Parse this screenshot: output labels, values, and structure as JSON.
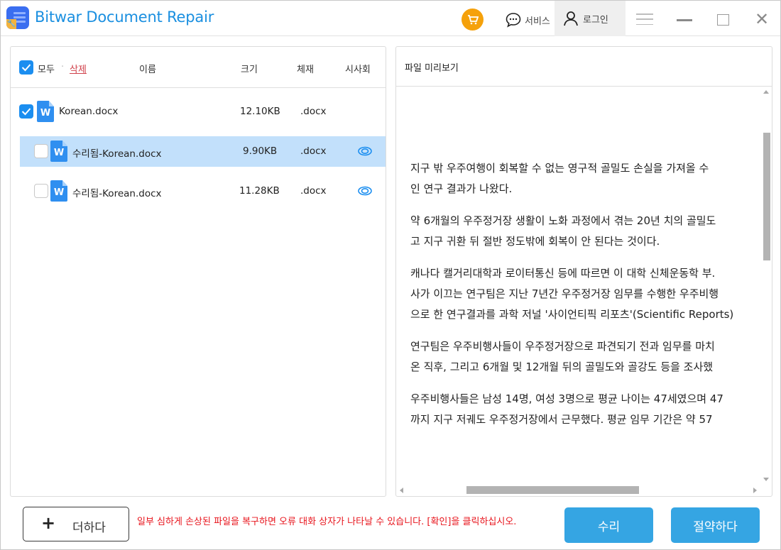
{
  "app": {
    "title": "Bitwar Document Repair"
  },
  "titlebar": {
    "service_label": "서비스",
    "login_label": "로그인",
    "cart_color": "#f5a10b"
  },
  "file_list": {
    "header": {
      "select_all_label": "모두",
      "separator": "·",
      "delete_label": "삭제",
      "name_col": "이름",
      "size_col": "크기",
      "format_col": "체재",
      "preview_col": "시사회",
      "select_all_checked": true
    },
    "rows": [
      {
        "name": "Korean.docx",
        "size": "12.10KB",
        "format": ".docx",
        "checked": true,
        "selected": false,
        "level": 0,
        "has_preview": false
      },
      {
        "name": "수리됨-Korean.docx",
        "size": "9.90KB",
        "format": ".docx",
        "checked": false,
        "selected": true,
        "level": 1,
        "has_preview": true
      },
      {
        "name": "수리됨-Korean.docx",
        "size": "11.28KB",
        "format": ".docx",
        "checked": false,
        "selected": false,
        "level": 1,
        "has_preview": true
      }
    ],
    "icon_letter": "W"
  },
  "preview": {
    "title": "파일 미리보기",
    "paragraphs": [
      [
        "지구 밖 우주여행이 회복할 수 없는 영구적 골밀도 손실을 가져올 수",
        "인 연구 결과가 나왔다."
      ],
      [
        "약 6개월의 우주정거장 생활이 노화 과정에서 겪는 20년 치의 골밀도",
        "고 지구 귀환 뒤 절반 정도밖에 회복이 안 된다는 것이다."
      ],
      [
        "캐나다 캘거리대학과 로이터통신 등에 따르면 이 대학 신체운동학 부.",
        "사가 이끄는 연구팀은 지난 7년간 우주정거장 임무를 수행한 우주비행",
        "으로 한 연구결과를 과학 저널 '사이언티픽 리포츠'(Scientific Reports)"
      ],
      [
        "연구팀은 우주비행사들이 우주정거장으로 파견되기 전과 임무를 마치",
        "온 직후, 그리고 6개월 및 12개월 뒤의 골밀도와 골강도 등을 조사했"
      ],
      [
        "우주비행사들은 남성 14명, 여성 3명으로 평균 나이는 47세였으며 47",
        "까지 지구 저궤도 우주정거장에서 근무했다. 평균 임무 기간은 약 57"
      ]
    ]
  },
  "footer": {
    "add_label": "더하다",
    "warning": "일부 심하게 손상된 파일을 복구하면 오류 대화 상자가 나타날 수 있습니다. [확인]을 클릭하십시오.",
    "repair_label": "수리",
    "save_label": "절약하다",
    "accent_color": "#35a5e3",
    "warning_color": "#e8141c"
  }
}
